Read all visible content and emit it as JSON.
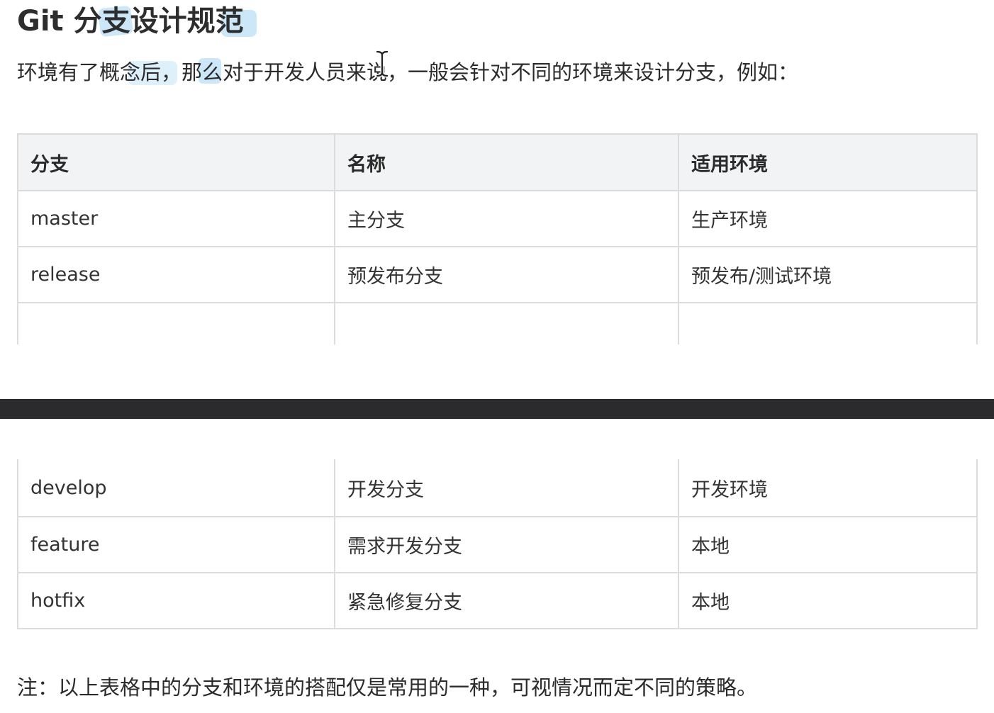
{
  "title": "Git 分支设计规范",
  "intro": "环境有了概念后，那么对于开发人员来说，一般会针对不同的环境来设计分支，例如：",
  "table": {
    "headers": [
      "分支",
      "名称",
      "适用环境"
    ],
    "rows_top": [
      [
        "master",
        "主分支",
        "生产环境"
      ],
      [
        "release",
        "预发布分支",
        "预发布/测试环境"
      ]
    ],
    "rows_bottom": [
      [
        "develop",
        "开发分支",
        "开发环境"
      ],
      [
        "feature",
        "需求开发分支",
        "本地"
      ],
      [
        "hotfix",
        "紧急修复分支",
        "本地"
      ]
    ]
  },
  "note": "注：以上表格中的分支和环境的搭配仅是常用的一种，可视情况而定不同的策略。",
  "colors": {
    "header_bg": "#f2f3f5",
    "border": "#dcdcdc",
    "highlight": "#46aae6",
    "divider": "#2b2b2d"
  },
  "icons": {
    "cursor": "text-cursor-icon"
  }
}
